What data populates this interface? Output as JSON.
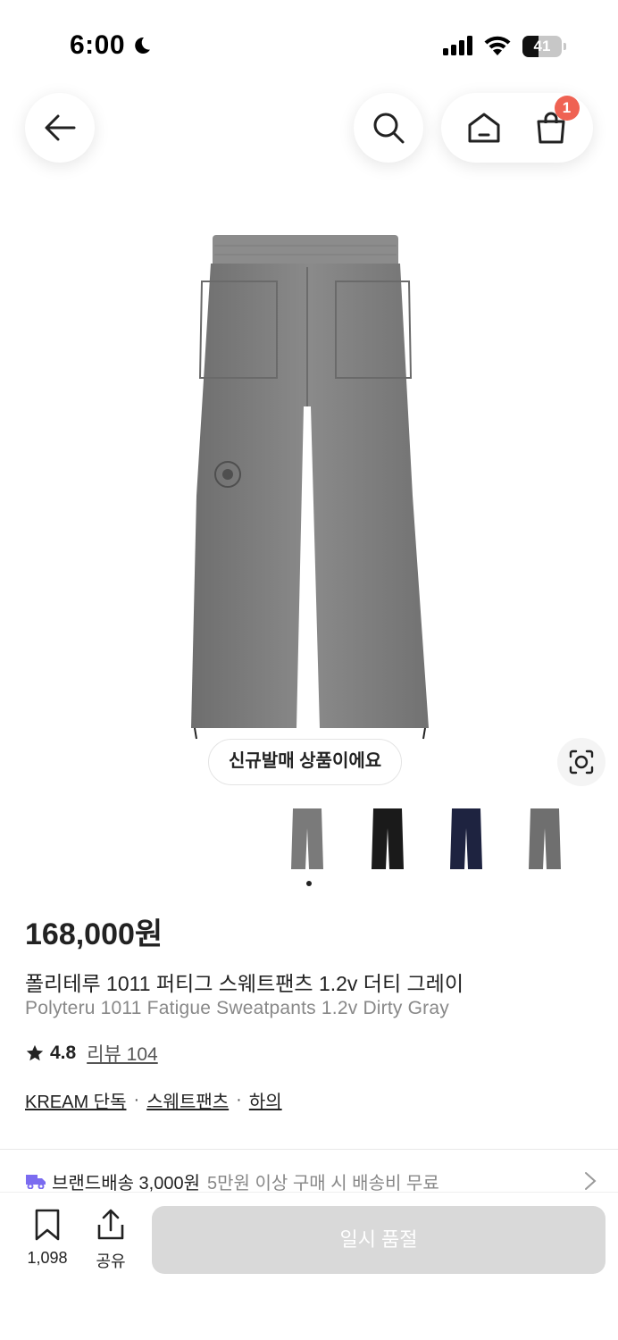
{
  "status_bar": {
    "time": "6:00",
    "battery": "41",
    "battery_fill": 0.41
  },
  "nav": {
    "cart_count": "1"
  },
  "product": {
    "new_release_label": "신규발매 상품이에요",
    "price": "168,000원",
    "title_ko": "폴리테루 1011 퍼티그 스웨트팬츠 1.2v 더티 그레이",
    "title_en": "Polyteru 1011 Fatigue Sweatpants 1.2v Dirty Gray",
    "rating": "4.8",
    "reviews": "리뷰 104",
    "tags": [
      "KREAM 단독",
      "스웨트팬츠",
      "하의"
    ],
    "thumbnail_colors": [
      "#7a7a7a",
      "#1a1a1a",
      "#1e2340",
      "#6f6f6f"
    ]
  },
  "shipping": {
    "main": "브랜드배송 3,000원",
    "sub": "5만원 이상 구매 시 배송비 무료"
  },
  "bottom_bar": {
    "bookmark_count": "1,098",
    "share_label": "공유",
    "sold_out_label": "일시 품절"
  },
  "colors": {
    "accent_badge": "#ef6253",
    "truck": "#7b6cf0"
  }
}
